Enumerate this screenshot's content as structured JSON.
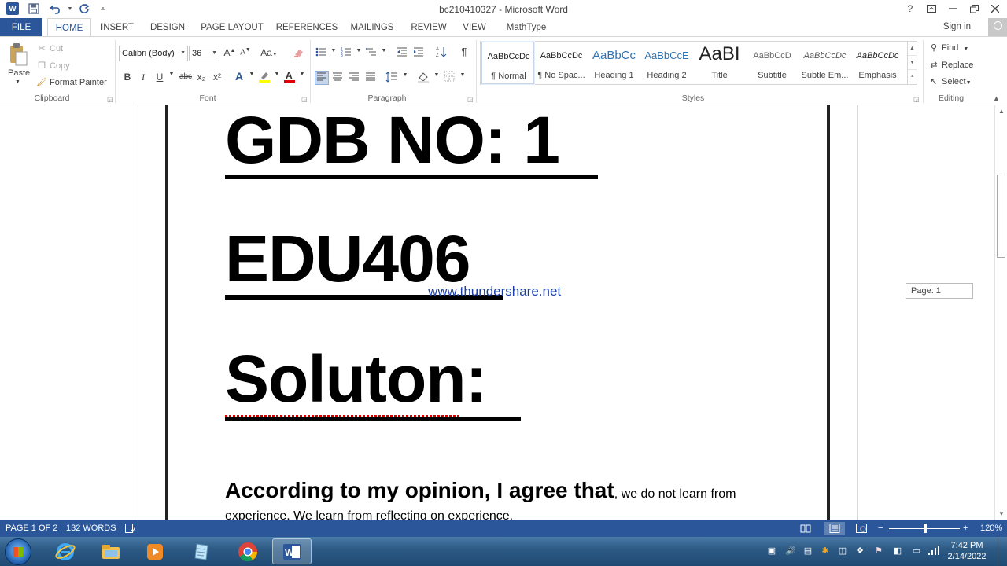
{
  "window": {
    "title": "bc210410327 - Microsoft Word",
    "help": "?",
    "controls": [
      "restore-ribbon",
      "minimize",
      "maximize",
      "close"
    ]
  },
  "tabs": [
    {
      "label": "FILE"
    },
    {
      "label": "HOME"
    },
    {
      "label": "INSERT"
    },
    {
      "label": "DESIGN"
    },
    {
      "label": "PAGE LAYOUT"
    },
    {
      "label": "REFERENCES"
    },
    {
      "label": "MAILINGS"
    },
    {
      "label": "REVIEW"
    },
    {
      "label": "VIEW"
    },
    {
      "label": "MathType"
    }
  ],
  "signin": "Sign in",
  "clipboard": {
    "paste": "Paste",
    "cut": "Cut",
    "copy": "Copy",
    "format_painter": "Format Painter",
    "group": "Clipboard"
  },
  "font": {
    "name": "Calibri (Body)",
    "size": "36",
    "group": "Font",
    "case_label": "Aa",
    "bold": "B",
    "italic": "I",
    "underline": "U",
    "strike": "abc",
    "sub": "x₂",
    "sup": "x²"
  },
  "paragraph": {
    "group": "Paragraph",
    "pilcrow": "¶"
  },
  "styles": {
    "group": "Styles",
    "items": [
      {
        "sample": "AaBbCcDc",
        "name": "¶ Normal"
      },
      {
        "sample": "AaBbCcDc",
        "name": "¶ No Spac..."
      },
      {
        "sample": "AaBbCc",
        "name": "Heading 1"
      },
      {
        "sample": "AaBbCcE",
        "name": "Heading 2"
      },
      {
        "sample": "AaBI",
        "name": "Title"
      },
      {
        "sample": "AaBbCcD",
        "name": "Subtitle"
      },
      {
        "sample": "AaBbCcDc",
        "name": "Subtle Em..."
      },
      {
        "sample": "AaBbCcDc",
        "name": "Emphasis"
      }
    ]
  },
  "editing": {
    "group": "Editing",
    "find": "Find",
    "replace": "Replace",
    "select": "Select"
  },
  "document": {
    "line1": "GDB NO: 1",
    "line2": "EDU406",
    "line3": "Soluton:",
    "watermark": "www.thundershare.net",
    "para_bold": "According to my opinion, I agree that",
    "para_normal": ", we do not learn from",
    "para_line2": "experience. We learn from reflecting on experience."
  },
  "page_indicator": "Page: 1",
  "status": {
    "page": "PAGE 1 OF 2",
    "words": "132 WORDS",
    "zoom": "120%",
    "zoom_fraction": 0.5,
    "minus": "−",
    "plus": "+"
  },
  "taskbar": {
    "time": "7:42 PM",
    "date": "2/14/2022"
  },
  "colors": {
    "accent": "#2b579a",
    "watermark": "#1b3fa6"
  }
}
